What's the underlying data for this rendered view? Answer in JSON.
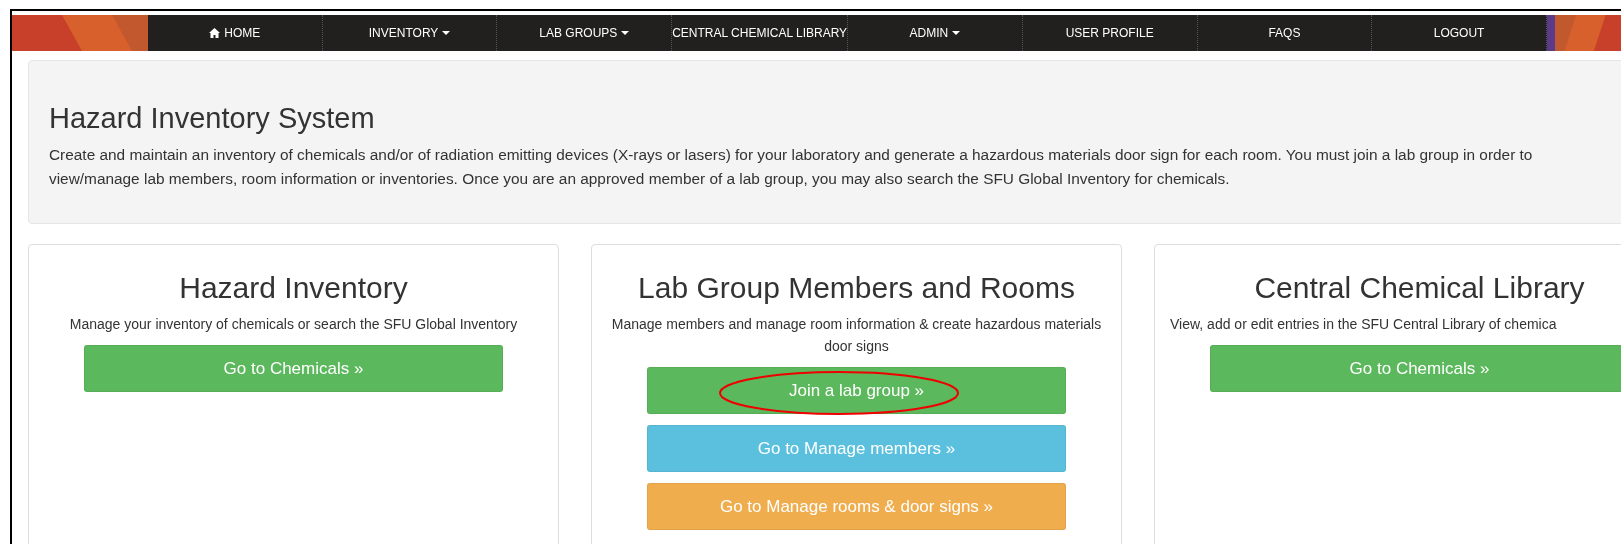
{
  "navbar": {
    "items": [
      {
        "label": "HOME",
        "dropdown": false
      },
      {
        "label": "INVENTORY",
        "dropdown": true
      },
      {
        "label": "LAB GROUPS",
        "dropdown": true
      },
      {
        "label": "CENTRAL CHEMICAL LIBRARY",
        "dropdown": false
      },
      {
        "label": "ADMIN",
        "dropdown": true
      },
      {
        "label": "USER PROFILE",
        "dropdown": false
      },
      {
        "label": "FAQS",
        "dropdown": false
      },
      {
        "label": "LOGOUT",
        "dropdown": false
      }
    ]
  },
  "jumbotron": {
    "title": "Hazard Inventory System",
    "lines": [
      "Create and maintain an inventory of chemicals and/or of radiation emitting devices (X-rays or lasers) for your laboratory and generate a hazardous materials door sign for each room. You must join a lab group in order to",
      "view/manage lab members, room information or inventories. Once you are an approved member of a lab group, you may also search the SFU Global Inventory for chemicals."
    ]
  },
  "cards": [
    {
      "title": "Hazard Inventory",
      "description": "Manage your inventory of chemicals or search the SFU Global Inventory",
      "buttons": [
        {
          "label": "Go to Chemicals »",
          "kind": "success",
          "highlighted": false
        }
      ]
    },
    {
      "title": "Lab Group Members and Rooms",
      "description": "Manage members and manage room information & create hazardous materials door signs",
      "buttons": [
        {
          "label": "Join a lab group »",
          "kind": "success",
          "highlighted": true
        },
        {
          "label": "Go to Manage members »",
          "kind": "info",
          "highlighted": false
        },
        {
          "label": "Go to Manage rooms & door signs »",
          "kind": "warning",
          "highlighted": false
        }
      ]
    },
    {
      "title": "Central Chemical Library",
      "description": "View, add or edit entries in the SFU Central Library of chemica",
      "buttons": [
        {
          "label": "Go to Chemicals »",
          "kind": "success",
          "highlighted": false
        }
      ]
    }
  ]
}
